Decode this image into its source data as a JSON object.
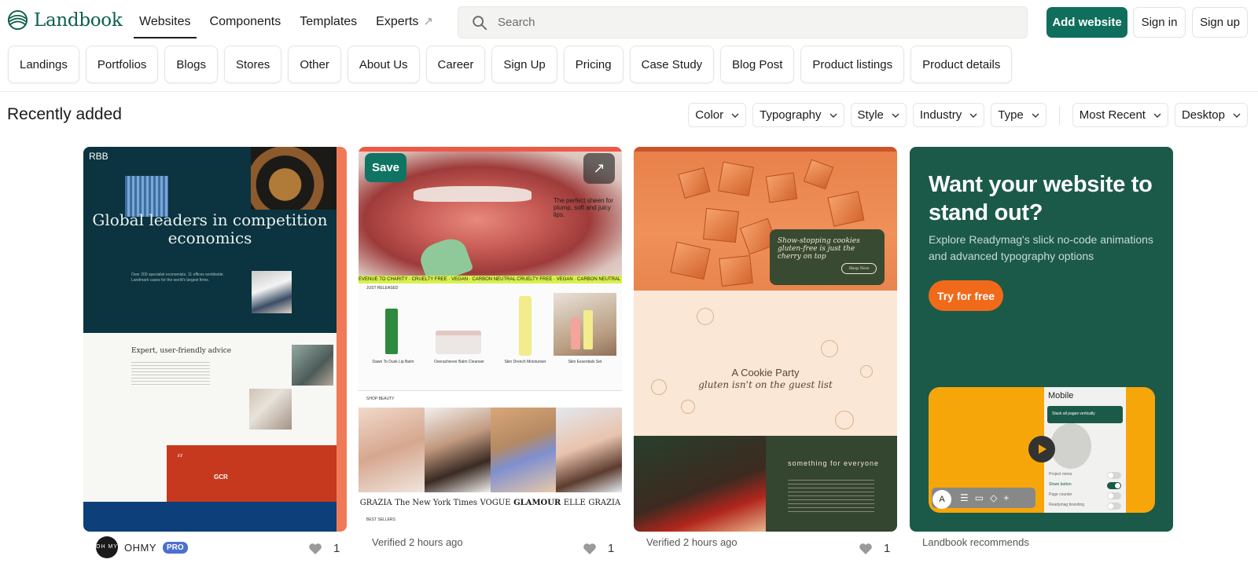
{
  "brand": {
    "name": "Landbook",
    "color": "#0f6e5c"
  },
  "nav": {
    "items": [
      {
        "label": "Websites",
        "active": true
      },
      {
        "label": "Components"
      },
      {
        "label": "Templates"
      },
      {
        "label": "Experts",
        "external": true
      }
    ]
  },
  "search": {
    "placeholder": "Search"
  },
  "actions": {
    "add_website": "Add website",
    "sign_in": "Sign in",
    "sign_up": "Sign up"
  },
  "categories": [
    "Landings",
    "Portfolios",
    "Blogs",
    "Stores",
    "Other",
    "About Us",
    "Career",
    "Sign Up",
    "Pricing",
    "Case Study",
    "Blog Post",
    "Product listings",
    "Product details"
  ],
  "section": {
    "title": "Recently added"
  },
  "filters": [
    "Color",
    "Typography",
    "Style",
    "Industry",
    "Type"
  ],
  "sort": {
    "order": "Most Recent",
    "device": "Desktop"
  },
  "cards": [
    {
      "preview": {
        "tag": "RBB",
        "headline": "Global leaders in competition economics",
        "subhead": "Expert, user-friendly advice",
        "blurb": "Over 200 specialist economists. 11 offices worldwide. Landmark cases for the world's largest firms.",
        "quote_logo": "GCR"
      },
      "author": {
        "initials": "OH MY",
        "name": "OHMY",
        "badge": "PRO"
      },
      "likes": "1"
    },
    {
      "preview": {
        "save_label": "Save",
        "hero_text": "The perfect sheen for plump, soft and juicy lips.",
        "ticker": "EVENUE TO CHARITY · CRUELTY FREE · VEGAN · CARBON NEUTRAL CRUELTY FREE · VEGAN · CARBON NEUTRAL · B CO",
        "section_label": "JUST RELEASED",
        "products": [
          "Dawn To Dusk Lip Balm",
          "Overachiever Balm Cleanser",
          "Skin Drench Moisturiser",
          "Skin Essentials Set"
        ],
        "shop_label": "SHOP BEAUTY",
        "press": [
          "GRAZIA",
          "The New York Times",
          "VOGUE",
          "GLAMOUR",
          "ELLE",
          "GRAZIA"
        ],
        "best_label": "BEST SELLERS"
      },
      "meta": "Verified 2 hours ago",
      "likes": "1"
    },
    {
      "preview": {
        "promo": "Show-stopping cookies gluten-free is just the cherry on top",
        "promo_button": "Shop Now",
        "title": "A Cookie Party",
        "subtitle": "gluten isn't on the guest list",
        "side_title": "something for everyone"
      },
      "meta": "Verified 2 hours ago",
      "likes": "1"
    },
    {
      "ad": {
        "title": "Want your website to stand out?",
        "text": "Explore Readymag's slick no-code animations and advanced typography options",
        "button": "Try for free",
        "panel_title": "Mobile",
        "panel_button": "Stack all pages vertically",
        "toggles": [
          "Project menu",
          "Share button",
          "Page counter",
          "Readymag branding"
        ],
        "avatar": "A"
      },
      "meta": "Landbook recommends"
    }
  ]
}
